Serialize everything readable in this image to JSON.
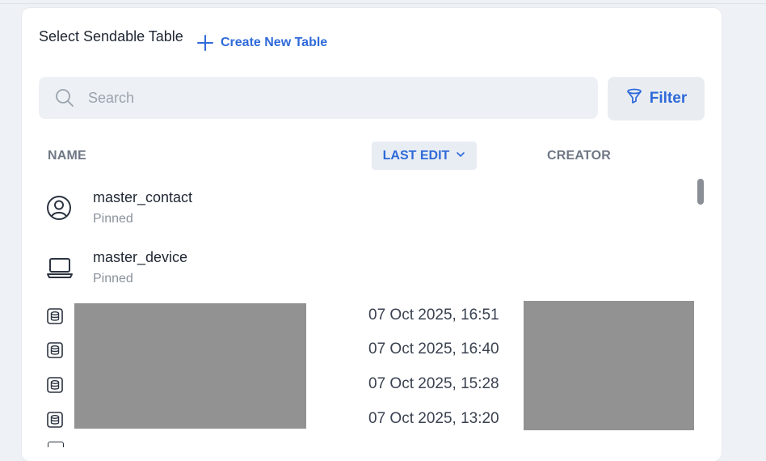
{
  "header": {
    "title": "Select Sendable Table",
    "create_label": "Create New Table"
  },
  "search": {
    "placeholder": "Search",
    "value": ""
  },
  "filter": {
    "label": "Filter"
  },
  "columns": {
    "name": "NAME",
    "last_edit": "LAST EDIT",
    "creator": "CREATOR"
  },
  "pinned_rows": [
    {
      "name": "master_contact",
      "status": "Pinned",
      "icon": "user-circle-icon"
    },
    {
      "name": "master_device",
      "status": "Pinned",
      "icon": "laptop-icon"
    }
  ],
  "rows": [
    {
      "last_edit": "07 Oct 2025, 16:51",
      "icon": "database-icon"
    },
    {
      "last_edit": "07 Oct 2025, 16:40",
      "icon": "database-icon"
    },
    {
      "last_edit": "07 Oct 2025, 15:28",
      "icon": "database-icon"
    },
    {
      "last_edit": "07 Oct 2025, 13:20",
      "icon": "database-icon"
    }
  ],
  "colors": {
    "accent": "#2f6ad9",
    "text": "#1f2733",
    "muted": "#8a929c",
    "redaction": "#929292"
  }
}
